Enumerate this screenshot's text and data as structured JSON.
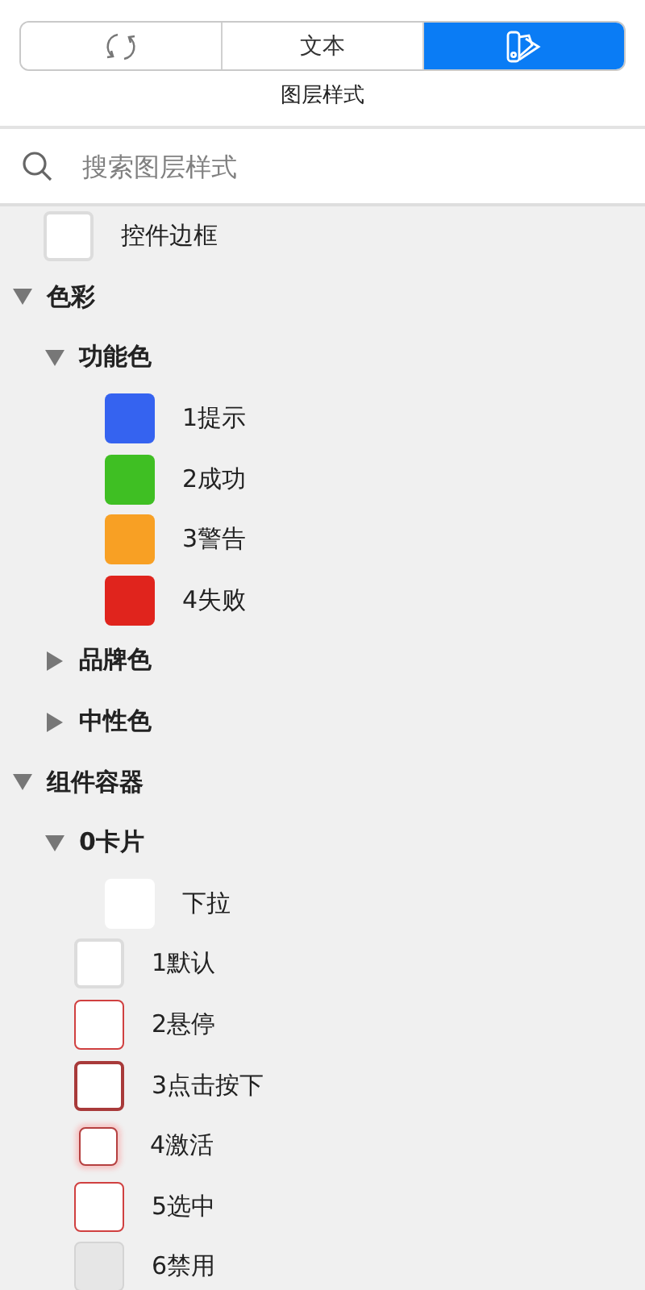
{
  "tabs": [
    {
      "kind": "icon",
      "selected": false
    },
    {
      "kind": "text",
      "label": "文本",
      "selected": false
    },
    {
      "kind": "icon",
      "selected": true
    }
  ],
  "panel_title": "图层样式",
  "search": {
    "placeholder": "搜索图层样式"
  },
  "tree": [
    {
      "kind": "outlined",
      "label": "控件边框"
    },
    {
      "kind": "group",
      "label": "色彩",
      "expanded": true,
      "children": [
        {
          "kind": "group",
          "label": "功能色",
          "expanded": true,
          "children": [
            {
              "kind": "fill",
              "label": "1提示",
              "color": "#3563f0"
            },
            {
              "kind": "fill",
              "label": "2成功",
              "color": "#3fbf23"
            },
            {
              "kind": "fill",
              "label": "3警告",
              "color": "#f8a024"
            },
            {
              "kind": "fill",
              "label": "4失败",
              "color": "#e0241d"
            }
          ]
        },
        {
          "kind": "group",
          "label": "品牌色",
          "expanded": false
        },
        {
          "kind": "group",
          "label": "中性色",
          "expanded": false
        }
      ]
    },
    {
      "kind": "group",
      "label": "组件容器",
      "expanded": true,
      "children": [
        {
          "kind": "group",
          "label": "0卡片",
          "expanded": true,
          "children": [
            {
              "kind": "blank",
              "label": "下拉"
            }
          ]
        },
        {
          "kind": "outlined",
          "label": "1默认"
        },
        {
          "kind": "red",
          "label": "2悬停"
        },
        {
          "kind": "darkred",
          "label": "3点击按下"
        },
        {
          "kind": "glow",
          "label": "4激活"
        },
        {
          "kind": "red",
          "label": "5选中"
        },
        {
          "kind": "disabled",
          "label": "6禁用"
        }
      ]
    }
  ]
}
